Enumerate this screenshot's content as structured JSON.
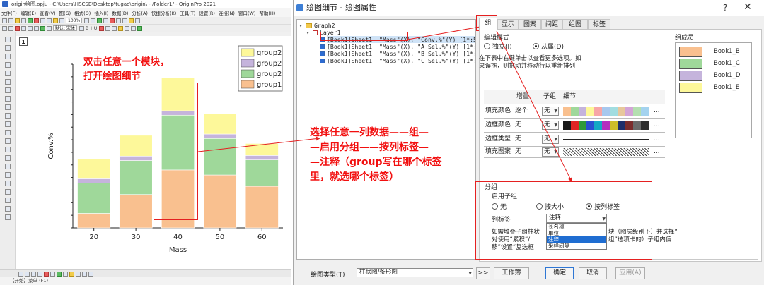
{
  "origin": {
    "title": "origin绘图.opju - C:\\Users\\HSCSB\\Desktop\\tugao\\origin\\ - /Folder1/ - OriginPro 2021",
    "menu": [
      "文件(F)",
      "编辑(E)",
      "查看(V)",
      "图(G)",
      "格式(O)",
      "插入(I)",
      "数据(D)",
      "分析(A)",
      "快捷分析(K)",
      "工具(T)",
      "设置(R)",
      "连接(N)",
      "窗口(W)",
      "帮助(H)"
    ],
    "toolbar": {
      "zoom": "100%",
      "font": "默认: 宋体",
      "layer_number": "1"
    },
    "status": "【开始】菜单 (F1)"
  },
  "chart_data": {
    "type": "bar",
    "stacked": true,
    "categories": [
      "20",
      "30",
      "40",
      "50",
      "60"
    ],
    "series": [
      {
        "name": "group1",
        "color": "#f9c08f",
        "values": [
          23,
          53,
          92,
          84,
          66
        ]
      },
      {
        "name": "group2",
        "color": "#9fd89a",
        "values": [
          48,
          54,
          87,
          58,
          42
        ]
      },
      {
        "name": "group2",
        "color": "#c5b4dc",
        "values": [
          7,
          7,
          7,
          7,
          7
        ]
      },
      {
        "name": "group2",
        "color": "#fdf89a",
        "values": [
          31,
          33,
          52,
          32,
          19
        ]
      }
    ],
    "xlabel": "Mass",
    "ylabel": "Conv.%",
    "ylim": [
      0,
      260
    ],
    "legend_position": "top-right",
    "grid": false
  },
  "annotations": {
    "left": [
      "双击任意一个模块，",
      "打开绘图细节"
    ],
    "right": [
      "选择任意一列数据——组—",
      "—启用分组——按列标签—",
      "—注释（group写在哪个标签",
      "里，就选哪个标签）"
    ]
  },
  "dialog": {
    "title": "绘图细节 - 绘图属性",
    "help": "?",
    "close": "✕",
    "tree": {
      "graph": "Graph2",
      "layer": "Layer1",
      "plots": [
        "[Book1]Sheet1! \"Mass\"(X), \"Conv.%\"(Y) [1*:5]",
        "[Book1]Sheet1! \"Mass\"(X), \"A Sel.%\"(Y) [1*:5]",
        "[Book1]Sheet1! \"Mass\"(X), \"B Sel.%\"(Y) [1*:5]",
        "[Book1]Sheet1! \"Mass\"(X), \"C Sel.%\"(Y) [1*:5]"
      ]
    },
    "tabs": [
      "组",
      "显示",
      "图案",
      "间距",
      "组图",
      "标签"
    ],
    "edit_mode": {
      "label": "编辑模式",
      "options": [
        "独立(I)",
        "从属(D)"
      ],
      "hint": [
        "在下表中右键单击以查看更多选项。如",
        "果误拖，则拖动并移动行以重新排列"
      ]
    },
    "grid": {
      "headers": [
        "增量",
        "子组",
        "细节"
      ],
      "rows": [
        {
          "label": "填充颜色",
          "inc": "逐个",
          "sub": "无"
        },
        {
          "label": "边框颜色",
          "inc": "无",
          "sub": "无"
        },
        {
          "label": "边框类型",
          "inc": "无",
          "sub": "无"
        },
        {
          "label": "填充图案",
          "inc": "无",
          "sub": "无"
        }
      ],
      "fill_colors": [
        "#f9c08f",
        "#9fd89a",
        "#c5b4dc",
        "#fdf89a",
        "#f7a6a6",
        "#a7c8ee",
        "#a2dde0",
        "#e7c79c",
        "#d3a4d6",
        "#b4dfb0",
        "#a4d3ef"
      ],
      "border_colors": [
        "#1a1a1a",
        "#e02424",
        "#2f9a3a",
        "#2a4fd1",
        "#14a8c4",
        "#b42fbf",
        "#cdbd2a",
        "#1f2f6b",
        "#7b2d2d",
        "#6b6b6b",
        "#2f2f2f"
      ],
      "more": "..."
    },
    "members": {
      "label": "组成员",
      "items": [
        {
          "name": "Book1_B",
          "color": "#f9c08f"
        },
        {
          "name": "Book1_C",
          "color": "#9fd89a"
        },
        {
          "name": "Book1_D",
          "color": "#c5b4dc"
        },
        {
          "name": "Book1_E",
          "color": "#fdf89a"
        }
      ]
    },
    "subgroup": {
      "title": "分组",
      "enable": "启用子组",
      "options": [
        "无",
        "按大小",
        "按列标签"
      ],
      "column_label": "列标签",
      "column_value": "注释",
      "dropdown_items": [
        "长名称",
        "单位",
        "注释",
        "采样间隔"
      ],
      "note_lines": [
        "如需堆叠子组柱状",
        "块（图层级别下）并选择“",
        "对使用“累积”/",
        "组”选项卡的）子组内偏",
        "移”设置”复选框"
      ]
    },
    "plot_type_label": "绘图类型(T)",
    "plot_type_value": "柱状图/条形图",
    "buttons": {
      "expand": ">>",
      "workbook": "工作簿",
      "ok": "确定",
      "cancel": "取消",
      "apply": "应用(A)"
    }
  }
}
